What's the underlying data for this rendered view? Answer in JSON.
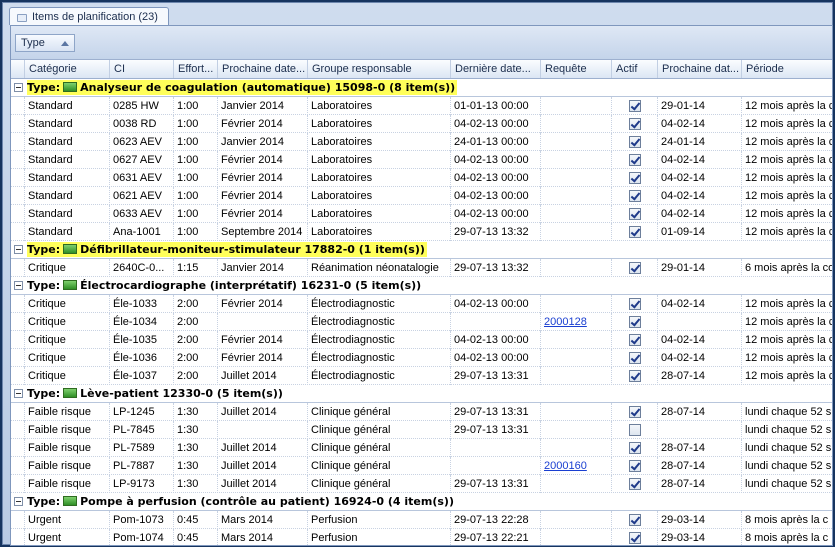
{
  "tab": {
    "title": "Items de planification (23)"
  },
  "group_panel": {
    "chip_label": "Type"
  },
  "columns": [
    "Catégorie",
    "CI",
    "Effort...",
    "Prochaine date...",
    "Groupe responsable",
    "Dernière date...",
    "Requête",
    "Actif",
    "Prochaine dat...",
    "Période"
  ],
  "groups": [
    {
      "label": "Type:",
      "name": "Analyseur de coagulation (automatique) 15098-0",
      "count": "(8 item(s))",
      "highlight": true,
      "rows": [
        {
          "categorie": "Standard",
          "ci": "0285 HW",
          "effort": "1:00",
          "prochaine": "Janvier 2014",
          "groupe": "Laboratoires",
          "derniere": "01-01-13 00:00",
          "requete": "",
          "actif": true,
          "prochaine2": "29-01-14",
          "periode": "12 mois après la c"
        },
        {
          "categorie": "Standard",
          "ci": "0038 RD",
          "effort": "1:00",
          "prochaine": "Février 2014",
          "groupe": "Laboratoires",
          "derniere": "04-02-13 00:00",
          "requete": "",
          "actif": true,
          "prochaine2": "04-02-14",
          "periode": "12 mois après la c"
        },
        {
          "categorie": "Standard",
          "ci": "0623 AEV",
          "effort": "1:00",
          "prochaine": "Janvier 2014",
          "groupe": "Laboratoires",
          "derniere": "24-01-13 00:00",
          "requete": "",
          "actif": true,
          "prochaine2": "24-01-14",
          "periode": "12 mois après la c"
        },
        {
          "categorie": "Standard",
          "ci": "0627 AEV",
          "effort": "1:00",
          "prochaine": "Février 2014",
          "groupe": "Laboratoires",
          "derniere": "04-02-13 00:00",
          "requete": "",
          "actif": true,
          "prochaine2": "04-02-14",
          "periode": "12 mois après la c"
        },
        {
          "categorie": "Standard",
          "ci": "0631 AEV",
          "effort": "1:00",
          "prochaine": "Février 2014",
          "groupe": "Laboratoires",
          "derniere": "04-02-13 00:00",
          "requete": "",
          "actif": true,
          "prochaine2": "04-02-14",
          "periode": "12 mois après la c"
        },
        {
          "categorie": "Standard",
          "ci": "0621 AEV",
          "effort": "1:00",
          "prochaine": "Février 2014",
          "groupe": "Laboratoires",
          "derniere": "04-02-13 00:00",
          "requete": "",
          "actif": true,
          "prochaine2": "04-02-14",
          "periode": "12 mois après la c"
        },
        {
          "categorie": "Standard",
          "ci": "0633 AEV",
          "effort": "1:00",
          "prochaine": "Février 2014",
          "groupe": "Laboratoires",
          "derniere": "04-02-13 00:00",
          "requete": "",
          "actif": true,
          "prochaine2": "04-02-14",
          "periode": "12 mois après la c"
        },
        {
          "categorie": "Standard",
          "ci": "Ana-1001",
          "effort": "1:00",
          "prochaine": "Septembre 2014",
          "groupe": "Laboratoires",
          "derniere": "29-07-13 13:32",
          "requete": "",
          "actif": true,
          "prochaine2": "01-09-14",
          "periode": "12 mois après la c"
        }
      ]
    },
    {
      "label": "Type:",
      "name": "Défibrillateur-moniteur-stimulateur 17882-0",
      "count": "(1 item(s))",
      "highlight": true,
      "rows": [
        {
          "categorie": "Critique",
          "ci": "2640C-0...",
          "effort": "1:15",
          "prochaine": "Janvier 2014",
          "groupe": "Réanimation néonatalogie",
          "derniere": "29-07-13 13:32",
          "requete": "",
          "actif": true,
          "prochaine2": "29-01-14",
          "periode": "6 mois après la co"
        }
      ]
    },
    {
      "label": "Type:",
      "name": "Électrocardiographe (interprétatif) 16231-0",
      "count": "(5 item(s))",
      "highlight": false,
      "rows": [
        {
          "categorie": "Critique",
          "ci": "Éle-1033",
          "effort": "2:00",
          "prochaine": "Février 2014",
          "groupe": "Électrodiagnostic",
          "derniere": "04-02-13 00:00",
          "requete": "",
          "actif": true,
          "prochaine2": "04-02-14",
          "periode": "12 mois après la c"
        },
        {
          "categorie": "Critique",
          "ci": "Éle-1034",
          "effort": "2:00",
          "prochaine": "",
          "groupe": "Électrodiagnostic",
          "derniere": "",
          "requete": "2000128",
          "actif": true,
          "prochaine2": "",
          "periode": "12 mois après la c"
        },
        {
          "categorie": "Critique",
          "ci": "Éle-1035",
          "effort": "2:00",
          "prochaine": "Février 2014",
          "groupe": "Électrodiagnostic",
          "derniere": "04-02-13 00:00",
          "requete": "",
          "actif": true,
          "prochaine2": "04-02-14",
          "periode": "12 mois après la c"
        },
        {
          "categorie": "Critique",
          "ci": "Éle-1036",
          "effort": "2:00",
          "prochaine": "Février 2014",
          "groupe": "Électrodiagnostic",
          "derniere": "04-02-13 00:00",
          "requete": "",
          "actif": true,
          "prochaine2": "04-02-14",
          "periode": "12 mois après la c"
        },
        {
          "categorie": "Critique",
          "ci": "Éle-1037",
          "effort": "2:00",
          "prochaine": "Juillet 2014",
          "groupe": "Électrodiagnostic",
          "derniere": "29-07-13 13:31",
          "requete": "",
          "actif": true,
          "prochaine2": "28-07-14",
          "periode": "12 mois après la c"
        }
      ]
    },
    {
      "label": "Type:",
      "name": "Lève-patient 12330-0",
      "count": "(5 item(s))",
      "highlight": false,
      "rows": [
        {
          "categorie": "Faible risque",
          "ci": "LP-1245",
          "effort": "1:30",
          "prochaine": "Juillet 2014",
          "groupe": "Clinique général",
          "derniere": "29-07-13 13:31",
          "requete": "",
          "actif": true,
          "prochaine2": "28-07-14",
          "periode": "lundi chaque 52 s"
        },
        {
          "categorie": "Faible risque",
          "ci": "PL-7845",
          "effort": "1:30",
          "prochaine": "",
          "groupe": "Clinique général",
          "derniere": "29-07-13 13:31",
          "requete": "",
          "actif": false,
          "prochaine2": "",
          "periode": "lundi chaque 52 s"
        },
        {
          "categorie": "Faible risque",
          "ci": "PL-7589",
          "effort": "1:30",
          "prochaine": "Juillet 2014",
          "groupe": "Clinique général",
          "derniere": "",
          "requete": "",
          "actif": true,
          "prochaine2": "28-07-14",
          "periode": "lundi chaque 52 s"
        },
        {
          "categorie": "Faible risque",
          "ci": "PL-7887",
          "effort": "1:30",
          "prochaine": "Juillet 2014",
          "groupe": "Clinique général",
          "derniere": "",
          "requete": "2000160",
          "actif": true,
          "prochaine2": "28-07-14",
          "periode": "lundi chaque 52 s"
        },
        {
          "categorie": "Faible risque",
          "ci": "LP-9173",
          "effort": "1:30",
          "prochaine": "Juillet 2014",
          "groupe": "Clinique général",
          "derniere": "29-07-13 13:31",
          "requete": "",
          "actif": true,
          "prochaine2": "28-07-14",
          "periode": "lundi chaque 52 s"
        }
      ]
    },
    {
      "label": "Type:",
      "name": "Pompe à perfusion (contrôle au patient) 16924-0",
      "count": "(4 item(s))",
      "highlight": false,
      "rows": [
        {
          "categorie": "Urgent",
          "ci": "Pom-1073",
          "effort": "0:45",
          "prochaine": "Mars 2014",
          "groupe": "Perfusion",
          "derniere": "29-07-13 22:28",
          "requete": "",
          "actif": true,
          "prochaine2": "29-03-14",
          "periode": "8 mois après la c"
        },
        {
          "categorie": "Urgent",
          "ci": "Pom-1074",
          "effort": "0:45",
          "prochaine": "Mars 2014",
          "groupe": "Perfusion",
          "derniere": "29-07-13 22:21",
          "requete": "",
          "actif": true,
          "prochaine2": "29-03-14",
          "periode": "8 mois après la c"
        }
      ]
    }
  ]
}
